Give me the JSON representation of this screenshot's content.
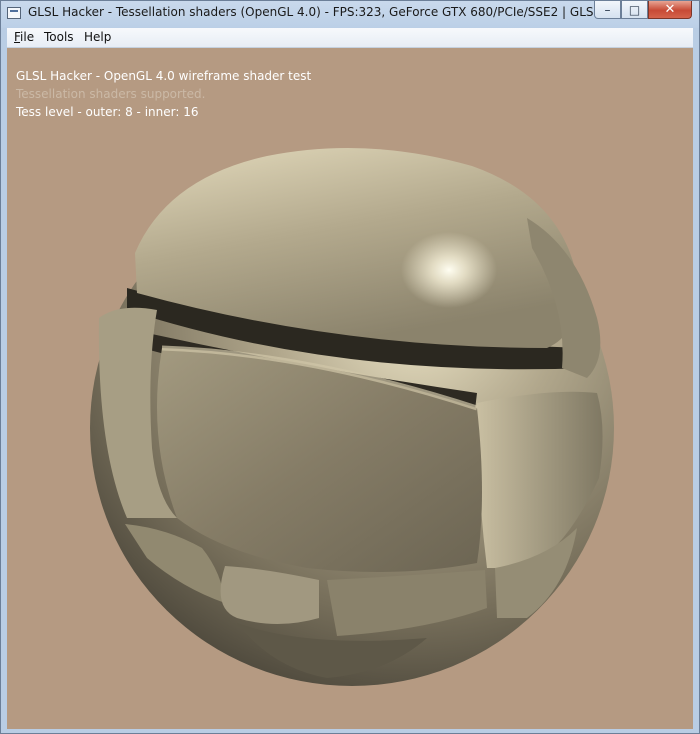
{
  "window": {
    "title": "GLSL Hacker - Tessellation shaders (OpenGL 4.0) - FPS:323, GeForce GTX 680/PCIe/SSE2 | GLSL Hacker (beta) (Win...",
    "controls": {
      "minimize": "–",
      "maximize": "□",
      "close": "✕"
    }
  },
  "menu": {
    "file": {
      "mnemonic": "F",
      "rest": "ile"
    },
    "tools": "Tools",
    "help": "Help"
  },
  "overlay": {
    "line1": "GLSL Hacker - OpenGL 4.0 wireframe shader test",
    "line2": "Tessellation shaders supported.",
    "line3": "Tess level - outer: 8 - inner: 16"
  },
  "colors": {
    "background": "#b59a82",
    "sphere": "#a49a80",
    "highlight": "#fffef2"
  },
  "icons": {
    "app": "app-window-icon",
    "minimize": "minimize-icon",
    "maximize": "maximize-icon",
    "close": "close-icon"
  }
}
